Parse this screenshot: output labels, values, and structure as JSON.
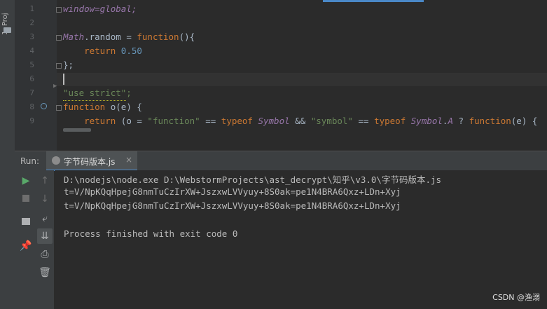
{
  "project_strip": {
    "label": "1: Proj"
  },
  "editor": {
    "lines": [
      {
        "num": "1",
        "text": "window=global;"
      },
      {
        "num": "2",
        "text": ""
      },
      {
        "num": "3",
        "text": "Math.random = function(){"
      },
      {
        "num": "4",
        "text": "    return 0.50"
      },
      {
        "num": "5",
        "text": "};"
      },
      {
        "num": "6",
        "text": ""
      },
      {
        "num": "7",
        "text": "\"use strict\";"
      },
      {
        "num": "8",
        "text": "function o(e) {"
      },
      {
        "num": "9",
        "text": "    return (o = \"function\" == typeof Symbol && \"symbol\" == typeof Symbol.A ? function(e) {"
      }
    ]
  },
  "run_panel": {
    "label": "Run:",
    "tab_title": "字节码版本.js",
    "tab_close": "×",
    "output": [
      "D:\\nodejs\\node.exe D:\\WebstormProjects\\ast_decrypt\\知乎\\v3.0\\字节码版本.js",
      "t=V/NpKQqHpejG8nmTuCzIrXW+JszxwLVVyuy+8S0ak=pe1N4BRA6Qxz+LDn+Xyj",
      "t=V/NpKQqHpejG8nmTuCzIrXW+JszxwLVVyuy+8S0ak=pe1N4BRA6Qxz+LDn+Xyj",
      "",
      "Process finished with exit code 0"
    ],
    "toolbar_icons": [
      "run-icon",
      "up-arrow-icon",
      "stop-icon",
      "down-arrow-icon",
      "layout-icon",
      "soft-wrap-icon",
      "scroll-to-end-icon",
      "pin-icon",
      "print-icon",
      "trash-icon"
    ]
  },
  "watermark": "CSDN @渔溺",
  "colors": {
    "keyword": "#cc7832",
    "number": "#6897bb",
    "string": "#6a8759",
    "global": "#9876aa",
    "accent": "#4a88c7"
  }
}
